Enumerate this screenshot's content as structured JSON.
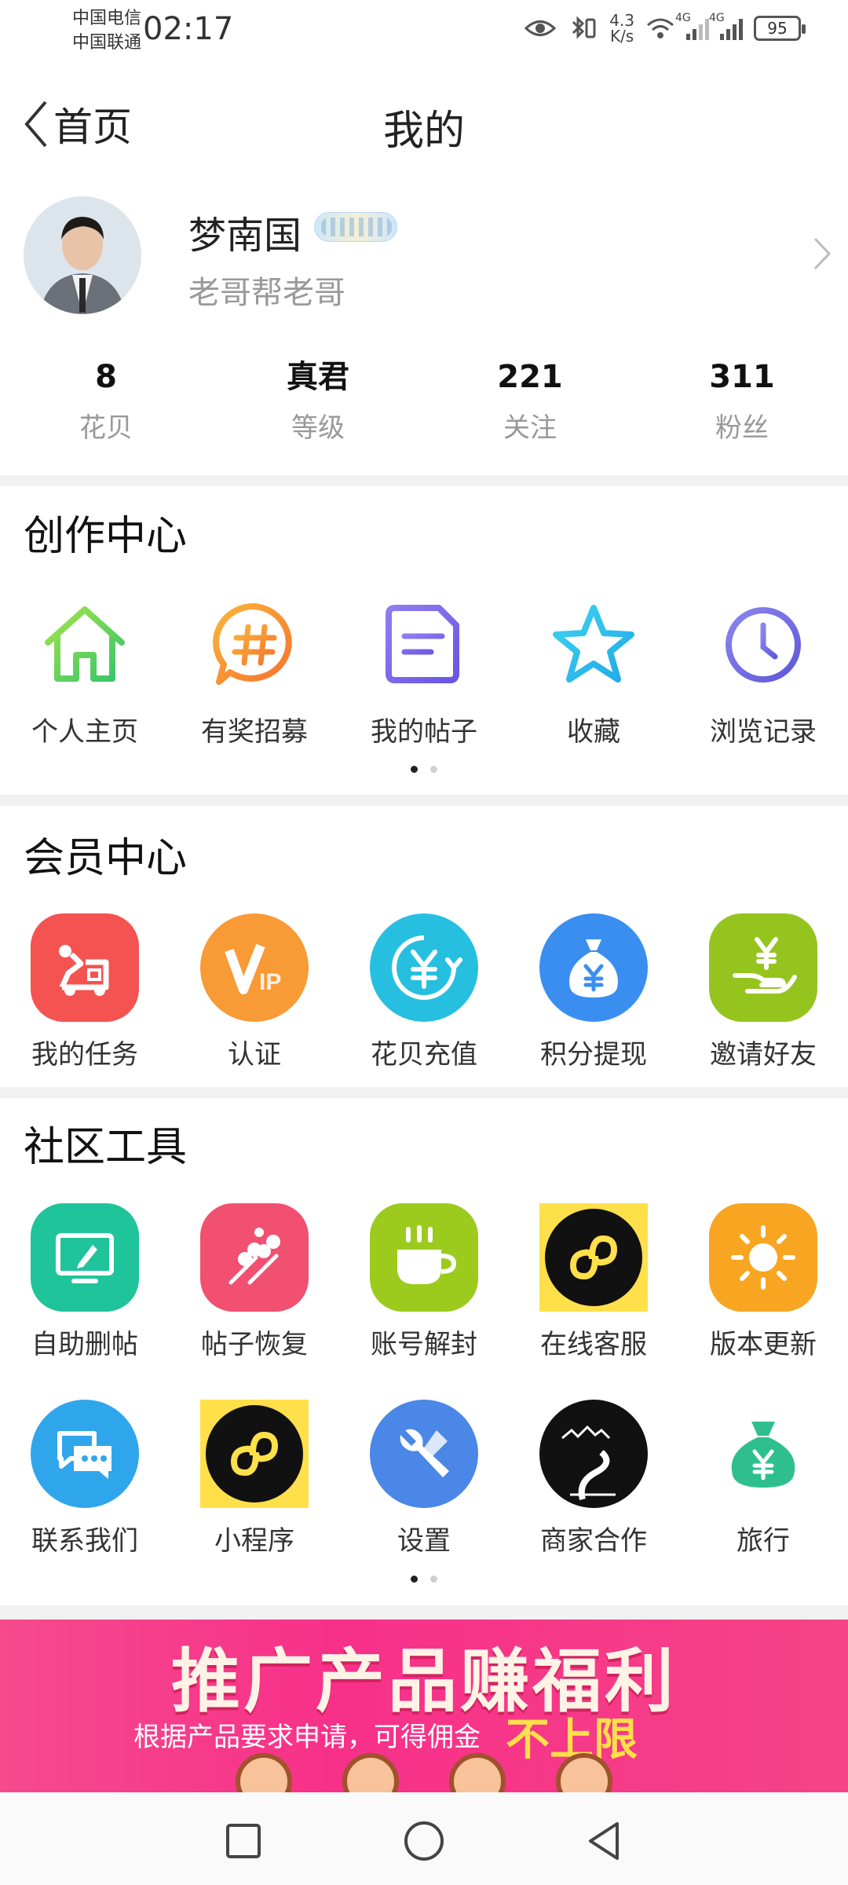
{
  "status_bar": {
    "carrier_1": "中国电信",
    "carrier_2": "中国联通",
    "time": "02:17",
    "net_speed_value": "4.3",
    "net_speed_unit": "K/s",
    "sim1_type": "4G",
    "sim2_type": "4G",
    "battery": "95"
  },
  "nav": {
    "back_label": "首页",
    "title": "我的"
  },
  "profile": {
    "username": "梦南国",
    "signature": "老哥帮老哥"
  },
  "stats": [
    {
      "value": "8",
      "label": "花贝"
    },
    {
      "value": "真君",
      "label": "等级"
    },
    {
      "value": "221",
      "label": "关注"
    },
    {
      "value": "311",
      "label": "粉丝"
    }
  ],
  "creation_center": {
    "title": "创作中心",
    "items": [
      {
        "label": "个人主页",
        "icon": "home-icon"
      },
      {
        "label": "有奖招募",
        "icon": "hashtag-icon"
      },
      {
        "label": "我的帖子",
        "icon": "post-icon"
      },
      {
        "label": "收藏",
        "icon": "star-icon"
      },
      {
        "label": "浏览记录",
        "icon": "clock-icon"
      }
    ]
  },
  "member_center": {
    "title": "会员中心",
    "items": [
      {
        "label": "我的任务",
        "icon": "task-icon",
        "color": "#f45352"
      },
      {
        "label": "认证",
        "icon": "vip-icon",
        "color": "#f89a35"
      },
      {
        "label": "花贝充值",
        "icon": "yuan-recharge-icon",
        "color": "#27bfe0"
      },
      {
        "label": "积分提现",
        "icon": "money-bag-icon",
        "color": "#3a8ef0"
      },
      {
        "label": "邀请好友",
        "icon": "invite-icon",
        "color": "#95c41f"
      }
    ]
  },
  "community_tools": {
    "title": "社区工具",
    "row1": [
      {
        "label": "自助删帖",
        "icon": "delete-post-icon",
        "color": "#20c49a"
      },
      {
        "label": "帖子恢复",
        "icon": "restore-icon",
        "color": "#f25070"
      },
      {
        "label": "账号解封",
        "icon": "coffee-cup-icon",
        "color": "#9ccb1d"
      },
      {
        "label": "在线客服",
        "icon": "mini-program-icon",
        "color": "#ffe04a"
      },
      {
        "label": "版本更新",
        "icon": "sun-icon",
        "color": "#f8a522"
      }
    ],
    "row2": [
      {
        "label": "联系我们",
        "icon": "chat-icon",
        "color": "#2fa6ec"
      },
      {
        "label": "小程序",
        "icon": "mini-program-icon",
        "color": "#ffe04a"
      },
      {
        "label": "设置",
        "icon": "wrench-icon",
        "color": "#4a87e6"
      },
      {
        "label": "商家合作",
        "icon": "road-icon",
        "color": "#111111"
      },
      {
        "label": "旅行",
        "icon": "money-bag-icon",
        "color": "#2fbf8f"
      }
    ]
  },
  "banner": {
    "headline": "推广产品赚福利",
    "subline": "根据产品要求申请，可得佣金",
    "highlight": "不上限"
  }
}
